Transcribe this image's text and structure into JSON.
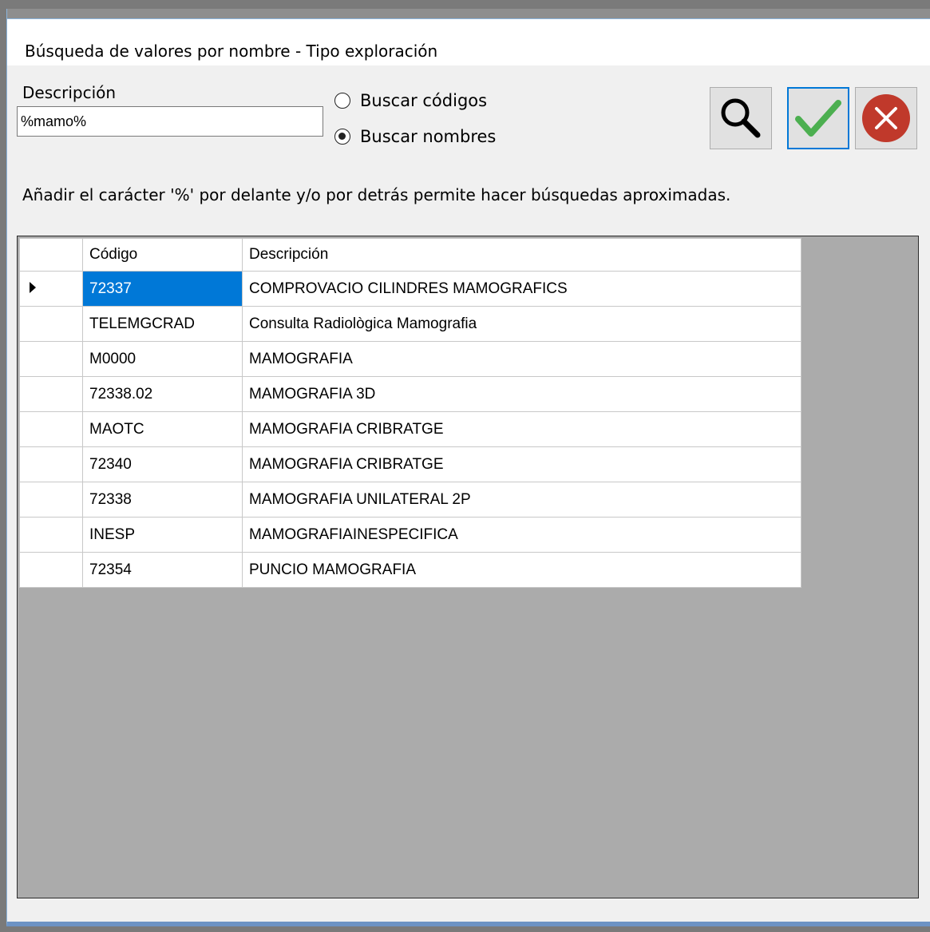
{
  "window": {
    "title": "Búsqueda de valores por nombre - Tipo exploración"
  },
  "form": {
    "description_label": "Descripción",
    "description_value": "%mamo%",
    "radio_codes_label": "Buscar códigos",
    "radio_names_label": "Buscar nombres",
    "selected_radio": "Buscar nombres",
    "hint": "Añadir el carácter '%' por delante y/o por detrás permite hacer búsquedas aproximadas."
  },
  "toolbar": {
    "search_icon": "magnifier-icon",
    "accept_icon": "checkmark-icon",
    "cancel_icon": "close-circle-icon",
    "accept_color": "#4caf50",
    "cancel_color": "#c0392b"
  },
  "grid": {
    "columns": [
      "Código",
      "Descripción"
    ],
    "selected_row": 0,
    "rows": [
      {
        "code": "72337",
        "desc": "COMPROVACIO CILINDRES MAMOGRAFICS"
      },
      {
        "code": "TELEMGCRAD",
        "desc": "Consulta Radiològica Mamografia"
      },
      {
        "code": "M0000",
        "desc": "MAMOGRAFIA"
      },
      {
        "code": "72338.02",
        "desc": "MAMOGRAFIA 3D"
      },
      {
        "code": "MAOTC",
        "desc": "MAMOGRAFIA CRIBRATGE"
      },
      {
        "code": "72340",
        "desc": "MAMOGRAFIA CRIBRATGE"
      },
      {
        "code": "72338",
        "desc": "MAMOGRAFIA UNILATERAL 2P"
      },
      {
        "code": "INESP",
        "desc": "MAMOGRAFIAINESPECIFICA"
      },
      {
        "code": "72354",
        "desc": "PUNCIO MAMOGRAFIA"
      }
    ]
  }
}
